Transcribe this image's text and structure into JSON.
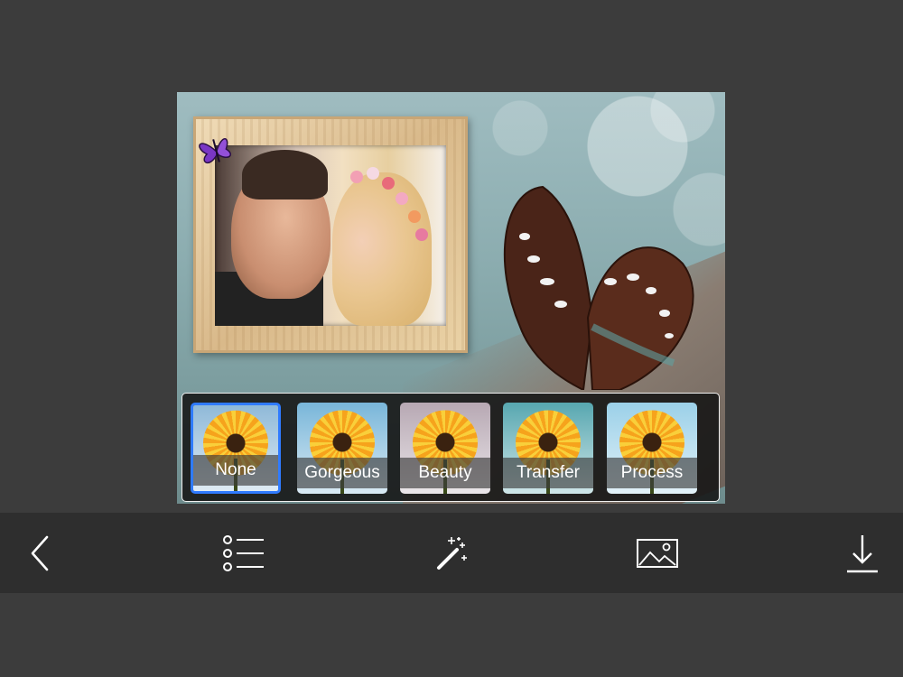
{
  "filters": [
    {
      "label": "None",
      "selected": true,
      "tint": "#8fb9d8"
    },
    {
      "label": "Gorgeous",
      "selected": false,
      "tint": "#79b6d9"
    },
    {
      "label": "Beauty",
      "selected": false,
      "tint": "#b7a8b3"
    },
    {
      "label": "Transfer",
      "selected": false,
      "tint": "#57a7b0"
    },
    {
      "label": "Process",
      "selected": false,
      "tint": "#9bd0e8"
    }
  ],
  "toolbar": {
    "back_icon": "chevron-left-icon",
    "list_icon": "list-icon",
    "effects_icon": "magic-wand-icon",
    "image_icon": "image-icon",
    "download_icon": "download-icon"
  },
  "colors": {
    "background": "#3c3c3c",
    "toolbar": "#2e2e2e",
    "selection": "#2f7bff",
    "icon": "#ffffff"
  }
}
